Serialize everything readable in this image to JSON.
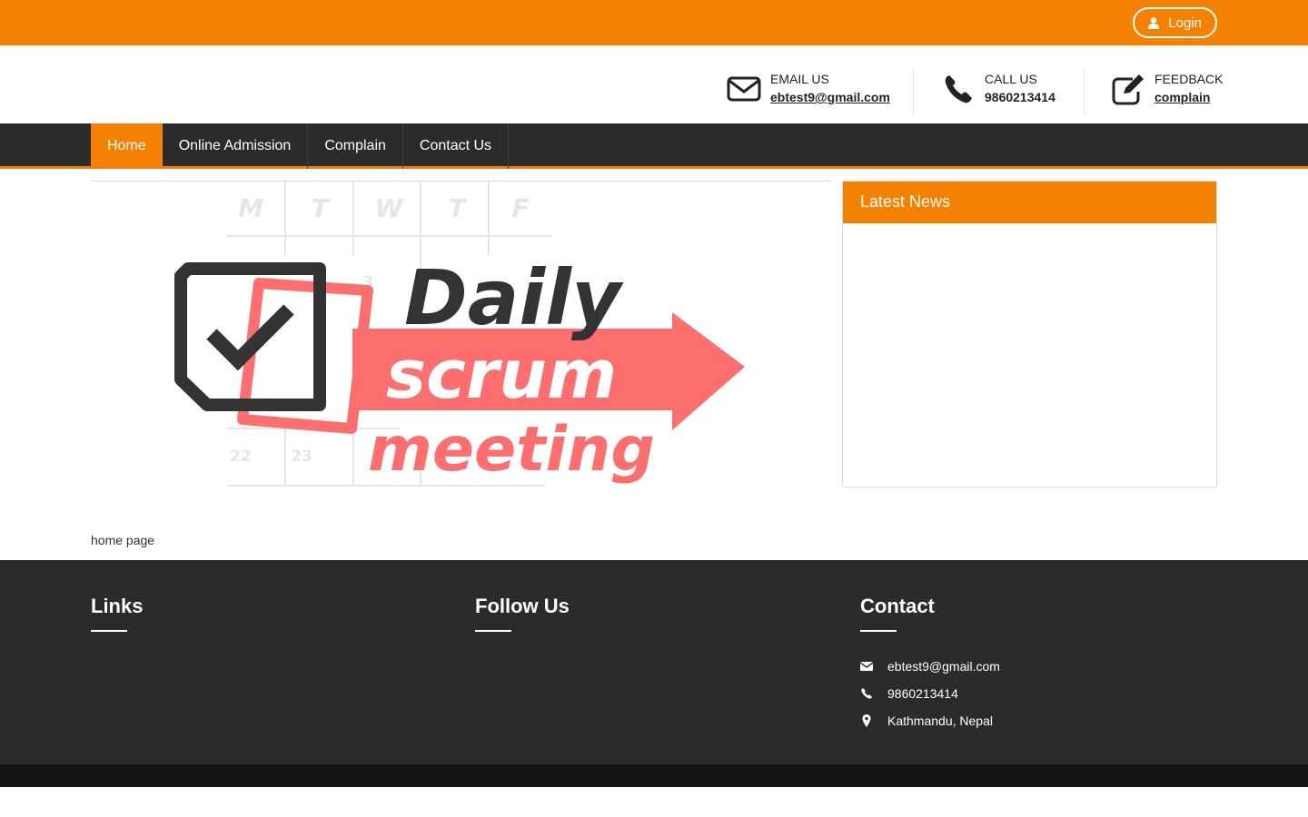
{
  "topbar": {
    "login_label": "Login"
  },
  "header": {
    "email": {
      "title": "EMAIL US",
      "value": "ebtest9@gmail.com",
      "icon": "envelope-icon"
    },
    "call": {
      "title": "CALL US",
      "value": "9860213414",
      "icon": "phone-icon"
    },
    "feedback": {
      "title": "FEEDBACK",
      "value": "complain",
      "icon": "edit-icon"
    }
  },
  "nav": {
    "items": [
      {
        "label": "Home",
        "active": true
      },
      {
        "label": "Online Admission"
      },
      {
        "label": "Complain"
      },
      {
        "label": "Contact Us"
      }
    ]
  },
  "banner": {
    "days": [
      "M",
      "T",
      "W",
      "T",
      "F"
    ],
    "numbers": [
      "3",
      "22",
      "23"
    ],
    "line1": "Daily",
    "line2": "scrum",
    "line3": "meeting"
  },
  "news": {
    "title": "Latest News"
  },
  "main": {
    "text": "home page"
  },
  "footer": {
    "links_title": "Links",
    "follow_title": "Follow Us",
    "contact_title": "Contact",
    "contact": {
      "email": "ebtest9@gmail.com",
      "phone": "9860213414",
      "address": "Kathmandu, Nepal"
    }
  },
  "colors": {
    "accent": "#f58102",
    "dark": "#2b2b2b",
    "banner_red": "#fd6f6f"
  }
}
